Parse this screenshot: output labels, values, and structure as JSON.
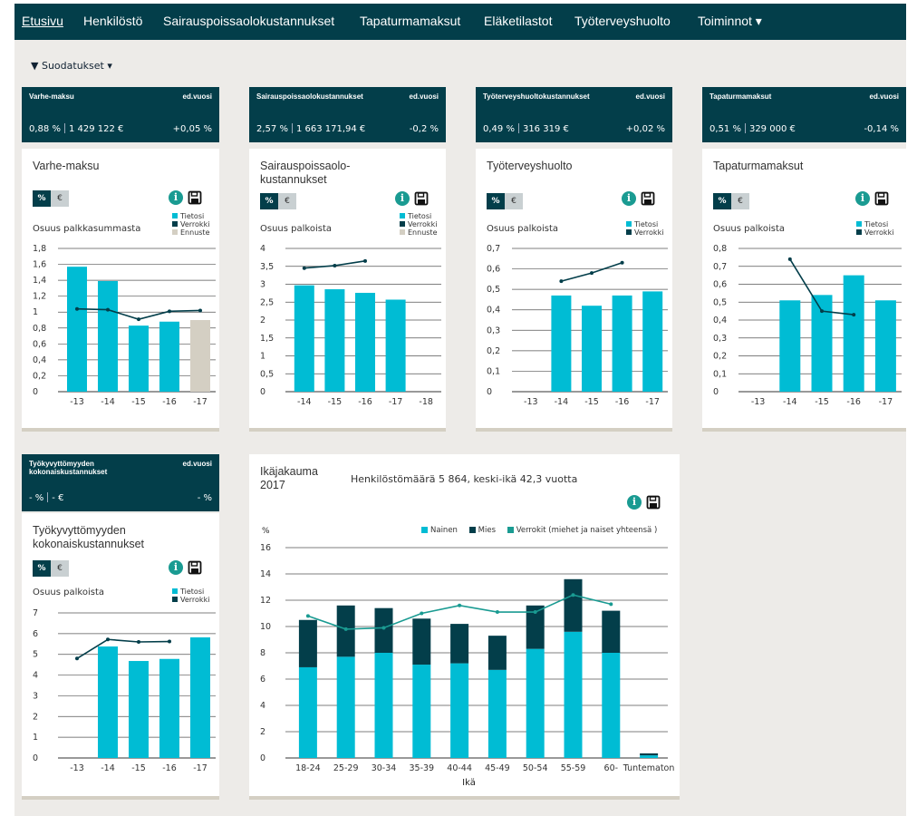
{
  "nav": {
    "items": [
      "Etusivu",
      "Henkilöstö",
      "Sairauspoissaolokustannukset",
      "Tapaturmamaksut",
      "Eläketilastot",
      "Työterveyshuolto"
    ],
    "actions_label": "Toiminnot ▾"
  },
  "filter": {
    "label": "Suodatukset ▾",
    "icon": "filter-icon"
  },
  "colors": {
    "dark": "#033e4a",
    "tietosi": "#00bcd4",
    "ennuste": "#d4cfc3",
    "verrokit_line": "#1a9b92",
    "info": "#1a9b92"
  },
  "common": {
    "prev_year_label": "ed.vuosi",
    "pct_label": "%",
    "eur_label": "€",
    "legend_tietosi": "Tietosi",
    "legend_verrokki": "Verrokki",
    "legend_ennuste": "Ennuste"
  },
  "kpis": [
    {
      "title": "Varhe-maksu",
      "pct": "0,88 %",
      "amount": "1 429 122 €",
      "change": "+0,05 %"
    },
    {
      "title": "Sairauspoissaolokustannukset",
      "pct": "2,57 %",
      "amount": "1 663 171,94 €",
      "change": "-0,2 %"
    },
    {
      "title": "Työterveyshuoltokustannukset",
      "pct": "0,49 %",
      "amount": "316 319 €",
      "change": "+0,02 %"
    },
    {
      "title": "Tapaturmamaksut",
      "pct": "0,51 %",
      "amount": "329 000 €",
      "change": "-0,14 %"
    },
    {
      "title": "Työkyvyttömyyden kokonaiskustannukset",
      "pct": "- %",
      "amount": "- €",
      "change": "- %"
    }
  ],
  "cards": [
    {
      "title": "Varhe-maksu",
      "ylabel": "Osuus palkkasummasta"
    },
    {
      "title": "Sairauspoissaolo-\nkustannukset",
      "ylabel": "Osuus palkoista"
    },
    {
      "title": "Työterveyshuolto",
      "ylabel": "Osuus palkoista"
    },
    {
      "title": "Tapaturmamaksut",
      "ylabel": "Osuus palkoista"
    },
    {
      "title": "Työkyvyttömyyden\nkokonaiskustannukset",
      "ylabel": "Osuus palkoista"
    }
  ],
  "age_card": {
    "title": "Ikäjakauma\n2017",
    "subtitle": "Henkilöstömäärä 5 864, keski-ikä 42,3 vuotta",
    "legend": [
      "Nainen",
      "Mies",
      "Verrokit (miehet ja naiset yhteensä )"
    ],
    "ylabel": "%",
    "xlabel": "Ikä"
  },
  "chart_data": [
    {
      "type": "bar",
      "title": "Varhe-maksu",
      "ylabel": "Osuus palkkasummasta",
      "categories": [
        "-13",
        "-14",
        "-15",
        "-16",
        "-17"
      ],
      "yticks": [
        "0",
        "0,2",
        "0,4",
        "0,6",
        "0,8",
        "1",
        "1,2",
        "1,4",
        "1,6",
        "1,8"
      ],
      "ylim": [
        0,
        1.8
      ],
      "series": [
        {
          "name": "Tietosi",
          "values": [
            1.57,
            1.39,
            0.83,
            0.88,
            null
          ]
        },
        {
          "name": "Ennuste",
          "values": [
            null,
            null,
            null,
            null,
            0.9
          ]
        },
        {
          "name": "Verrokki",
          "values": [
            1.04,
            1.03,
            0.91,
            1.01,
            1.02
          ]
        }
      ]
    },
    {
      "type": "bar",
      "title": "Sairauspoissaolokustannukset",
      "ylabel": "Osuus palkoista",
      "categories": [
        "-14",
        "-15",
        "-16",
        "-17",
        "-18"
      ],
      "yticks": [
        "0",
        "0,5",
        "1",
        "1,5",
        "2",
        "2,5",
        "3",
        "3,5",
        "4"
      ],
      "ylim": [
        0,
        4
      ],
      "series": [
        {
          "name": "Tietosi",
          "values": [
            2.97,
            2.86,
            2.76,
            2.57,
            null
          ]
        },
        {
          "name": "Verrokki",
          "values": [
            3.45,
            3.52,
            3.65,
            null,
            null
          ]
        }
      ]
    },
    {
      "type": "bar",
      "title": "Työterveyshuolto",
      "ylabel": "Osuus palkoista",
      "categories": [
        "-13",
        "-14",
        "-15",
        "-16",
        "-17"
      ],
      "yticks": [
        "0",
        "0,1",
        "0,2",
        "0,3",
        "0,4",
        "0,5",
        "0,6",
        "0,7"
      ],
      "ylim": [
        0,
        0.7
      ],
      "series": [
        {
          "name": "Tietosi",
          "values": [
            null,
            0.47,
            0.42,
            0.47,
            0.49
          ]
        },
        {
          "name": "Verrokki",
          "values": [
            null,
            0.54,
            0.58,
            0.63,
            null
          ]
        }
      ]
    },
    {
      "type": "bar",
      "title": "Tapaturmamaksut",
      "ylabel": "Osuus palkoista",
      "categories": [
        "-13",
        "-14",
        "-15",
        "-16",
        "-17"
      ],
      "yticks": [
        "0",
        "0,1",
        "0,2",
        "0,3",
        "0,4",
        "0,5",
        "0,6",
        "0,7",
        "0,8"
      ],
      "ylim": [
        0,
        0.8
      ],
      "series": [
        {
          "name": "Tietosi",
          "values": [
            null,
            0.51,
            0.54,
            0.65,
            0.51
          ]
        },
        {
          "name": "Verrokki",
          "values": [
            null,
            0.74,
            0.45,
            0.43,
            null
          ]
        }
      ]
    },
    {
      "type": "bar",
      "title": "Työkyvyttömyyden kokonaiskustannukset",
      "ylabel": "Osuus palkoista",
      "categories": [
        "-13",
        "-14",
        "-15",
        "-16",
        "-17"
      ],
      "yticks": [
        "0",
        "1",
        "2",
        "3",
        "4",
        "5",
        "6",
        "7"
      ],
      "ylim": [
        0,
        7
      ],
      "series": [
        {
          "name": "Tietosi",
          "values": [
            null,
            5.38,
            4.68,
            4.78,
            5.82
          ]
        },
        {
          "name": "Verrokki",
          "values": [
            4.8,
            5.72,
            5.6,
            5.62,
            null
          ]
        }
      ]
    },
    {
      "type": "bar",
      "title": "Ikäjakauma 2017",
      "xlabel": "Ikä",
      "ylabel": "%",
      "categories": [
        "18-24",
        "25-29",
        "30-34",
        "35-39",
        "40-44",
        "45-49",
        "50-54",
        "55-59",
        "60-",
        "Tuntematon"
      ],
      "yticks": [
        "0",
        "2",
        "4",
        "6",
        "8",
        "10",
        "12",
        "14",
        "16"
      ],
      "ylim": [
        0,
        16
      ],
      "stacked": true,
      "series": [
        {
          "name": "Nainen",
          "values": [
            6.9,
            7.7,
            8.0,
            7.1,
            7.2,
            6.7,
            8.3,
            9.6,
            8.0,
            0.2
          ]
        },
        {
          "name": "Mies",
          "values": [
            3.6,
            3.9,
            3.4,
            3.5,
            3.0,
            2.6,
            3.3,
            4.0,
            3.2,
            0.15
          ]
        },
        {
          "name": "Verrokit (miehet ja naiset yhteensä )",
          "values": [
            10.8,
            9.8,
            9.9,
            11.0,
            11.6,
            11.1,
            11.1,
            12.4,
            11.7,
            null
          ]
        }
      ]
    }
  ]
}
